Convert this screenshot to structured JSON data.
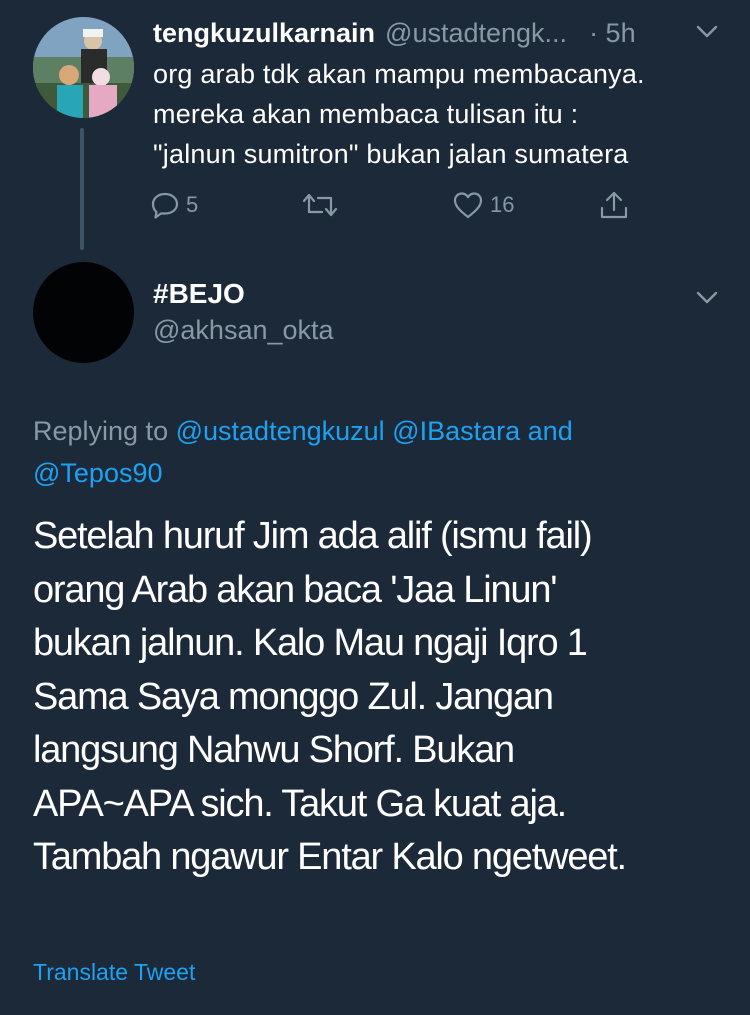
{
  "colors": {
    "background": "#1c2938",
    "text_primary": "#ffffff",
    "text_secondary": "#8899a6",
    "link": "#1da1f2"
  },
  "parent_tweet": {
    "display_name": "tengkuzulkarnain",
    "handle": "@ustadtengk...",
    "time": "· 5h",
    "avatar_icon": "family-photo-avatar",
    "text": "org arab tdk akan mampu membacanya.\nmereka akan membaca tulisan itu :\n\"jalnun sumitron\" bukan jalan sumatera",
    "actions": {
      "reply_icon": "reply-icon",
      "reply_count": "5",
      "retweet_icon": "retweet-icon",
      "like_icon": "heart-icon",
      "like_count": "16",
      "share_icon": "share-icon"
    }
  },
  "reply_tweet": {
    "display_name": "#BEJO",
    "handle": "@akhsan_okta",
    "avatar_icon": "dark-avatar",
    "replying_prefix": "Replying to",
    "replying_to": [
      "@ustadtengkuzul",
      "@IBastara"
    ],
    "replying_joiner": "and",
    "replying_last": "@Tepos90",
    "text": "Setelah huruf Jim ada alif (ismu fail)\norang Arab akan baca 'Jaa Linun'\nbukan jalnun. Kalo Mau ngaji Iqro 1\nSama Saya monggo Zul. Jangan\nlangsung Nahwu Shorf. Bukan\nAPA~APA sich. Takut Ga kuat aja.\nTambah ngawur Entar Kalo ngetweet.",
    "translate_label": "Translate Tweet"
  }
}
